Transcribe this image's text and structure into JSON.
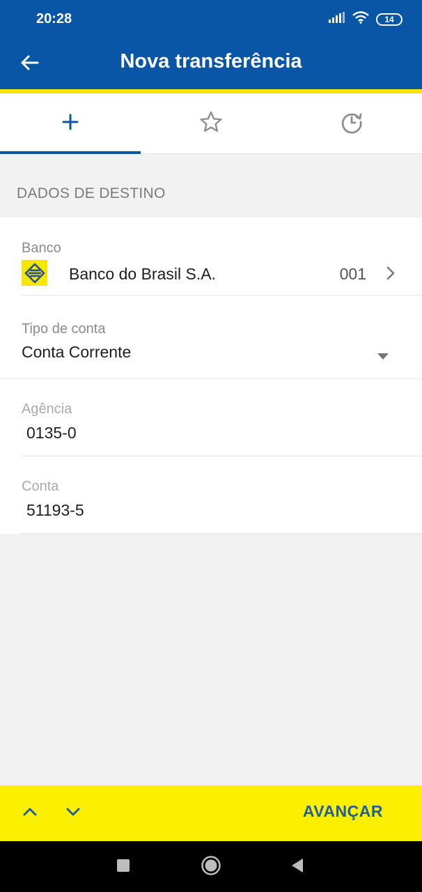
{
  "status_bar": {
    "time": "20:28",
    "battery": "14",
    "icons": [
      "signal-icon",
      "wifi-icon",
      "battery-icon"
    ]
  },
  "header": {
    "title": "Nova transferência",
    "back_icon": "arrow-left-icon"
  },
  "tabs": [
    {
      "icon": "plus-icon",
      "active": true
    },
    {
      "icon": "star-icon",
      "active": false
    },
    {
      "icon": "history-icon",
      "active": false
    }
  ],
  "section": {
    "label": "DADOS DE DESTINO"
  },
  "form": {
    "bank": {
      "label": "Banco",
      "value": "Banco do Brasil S.A.",
      "code": "001"
    },
    "account_type": {
      "label": "Tipo de conta",
      "value": "Conta Corrente"
    },
    "agency": {
      "label": "Agência",
      "value": "0135-0"
    },
    "account": {
      "label": "Conta",
      "value": "51193-5"
    }
  },
  "bottom_bar": {
    "advance_label": "AVANÇAR"
  },
  "colors": {
    "primary": "#0a56a6",
    "accent": "#f7e600",
    "bottom_bar": "#fcf000"
  }
}
